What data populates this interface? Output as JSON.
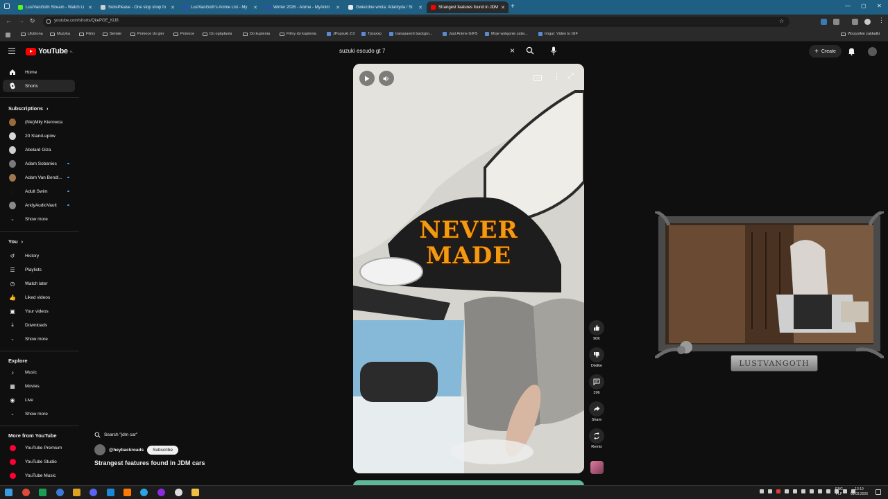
{
  "browser": {
    "tabs": [
      {
        "title": "LustVanGoth Stream - Watch Li",
        "color": "#53fc18",
        "active": false
      },
      {
        "title": "SubsPlease - One stop shop fo",
        "color": "#cfcfcf",
        "active": false
      },
      {
        "title": "LustVanGoth's Anime List - My",
        "color": "#2e51a2",
        "active": false
      },
      {
        "title": "Winter 2026 - Anime - MyAnim",
        "color": "#2e51a2",
        "active": false
      },
      {
        "title": "Gwiezdne wrota: Atlantyda / St",
        "color": "#e8e8e8",
        "active": false
      },
      {
        "title": "Strangest features found in JDM",
        "color": "#ff0000",
        "active": true
      }
    ],
    "url": "youtube.com/shorts/QkePGE_KiJ8",
    "bookmarks": [
      {
        "label": "Ulubiona",
        "kind": "folder"
      },
      {
        "label": "Muzyka",
        "kind": "folder"
      },
      {
        "label": "Filmy",
        "kind": "folder"
      },
      {
        "label": "Seriale",
        "kind": "folder"
      },
      {
        "label": "Pomoce do gier",
        "kind": "folder"
      },
      {
        "label": "Pomoce",
        "kind": "folder"
      },
      {
        "label": "Do oglądania",
        "kind": "folder"
      },
      {
        "label": "Do kupienia",
        "kind": "folder"
      },
      {
        "label": "Filmy do kupienia",
        "kind": "folder"
      },
      {
        "label": "JPopsuki 2.0",
        "kind": "site"
      },
      {
        "label": "Tpraxxp",
        "kind": "site"
      },
      {
        "label": "transparent backgro...",
        "kind": "site"
      },
      {
        "label": "Just Anime GIFS",
        "kind": "site"
      },
      {
        "label": "Moje wstępnie zatw...",
        "kind": "site"
      },
      {
        "label": "Imgur: Video to GIF",
        "kind": "site"
      }
    ],
    "all_bookmarks": "Wszystkie zakładki"
  },
  "header": {
    "logo_text": "YouTube",
    "country": "PL",
    "search_query": "suzuki escudo gt 7",
    "create_label": "Create"
  },
  "sidebar": {
    "main": [
      {
        "label": "Home",
        "icon": "home-icon"
      },
      {
        "label": "Shorts",
        "icon": "shorts-icon",
        "selected": true
      }
    ],
    "subscriptions_title": "Subscriptions",
    "subscriptions": [
      {
        "label": "(Nie)Miły Kierowca",
        "dot": false,
        "color": "#9a6a3a"
      },
      {
        "label": "20 Stand-upów",
        "dot": false,
        "color": "#d8d8d8"
      },
      {
        "label": "Abelard Giza",
        "dot": false,
        "color": "#cfcfcf"
      },
      {
        "label": "Adam Sobaniec",
        "dot": true,
        "color": "#7a7a7a"
      },
      {
        "label": "Adam Van Bendl...",
        "dot": true,
        "color": "#a07850"
      },
      {
        "label": "Adult Swim",
        "dot": true,
        "color": "#111111"
      },
      {
        "label": "AndyAudioVault",
        "dot": true,
        "color": "#8a8a8a"
      }
    ],
    "show_more": "Show more",
    "you_title": "You",
    "you": [
      {
        "label": "History",
        "icon": "history-icon"
      },
      {
        "label": "Playlists",
        "icon": "playlists-icon"
      },
      {
        "label": "Watch later",
        "icon": "watch-later-icon"
      },
      {
        "label": "Liked videos",
        "icon": "liked-videos-icon"
      },
      {
        "label": "Your videos",
        "icon": "your-videos-icon"
      },
      {
        "label": "Downloads",
        "icon": "downloads-icon"
      }
    ],
    "explore_title": "Explore",
    "explore": [
      {
        "label": "Music",
        "icon": "music-icon"
      },
      {
        "label": "Movies",
        "icon": "movies-icon"
      },
      {
        "label": "Live",
        "icon": "live-icon"
      }
    ],
    "more_title": "More from YouTube",
    "more": [
      {
        "label": "YouTube Premium"
      },
      {
        "label": "YouTube Studio"
      },
      {
        "label": "YouTube Music"
      }
    ]
  },
  "short": {
    "overlay_line1": "NEVER",
    "overlay_line2": "MADE",
    "search_suggestion": "Search \"jdm car\"",
    "channel": "@heybackroads",
    "subscribe_label": "Subscribe",
    "title": "Strangest features found in JDM cars",
    "actions": {
      "likes": "90K",
      "dislike_label": "Dislike",
      "comments": "396",
      "share_label": "Share",
      "remix_label": "Remix"
    }
  },
  "stream_overlay": {
    "name": "LUSTVANGOTH"
  },
  "taskbar": {
    "lang_line1": "ENG",
    "lang_line2": "PLP",
    "time": "13:19",
    "date": "03.03.2026"
  }
}
